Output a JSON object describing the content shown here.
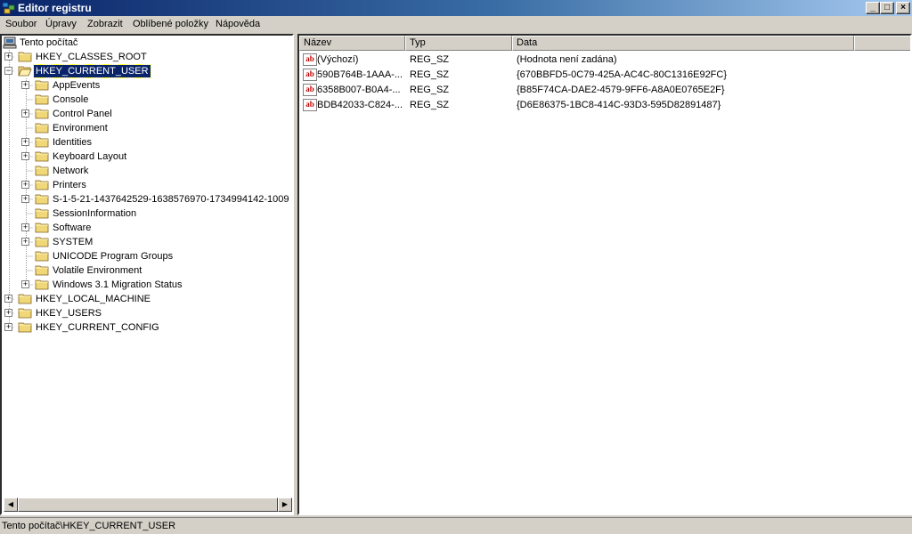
{
  "window": {
    "title": "Editor registru"
  },
  "menu": [
    "Soubor",
    "Úpravy",
    "Zobrazit",
    "Oblíbené položky",
    "Nápověda"
  ],
  "tree": {
    "root": "Tento počítač",
    "hives": [
      {
        "label": "HKEY_CLASSES_ROOT",
        "expander": "+"
      },
      {
        "label": "HKEY_CURRENT_USER",
        "expander": "−",
        "selected": true
      },
      {
        "label": "HKEY_LOCAL_MACHINE",
        "expander": "+"
      },
      {
        "label": "HKEY_USERS",
        "expander": "+"
      },
      {
        "label": "HKEY_CURRENT_CONFIG",
        "expander": "+"
      }
    ],
    "hkcu_children": [
      {
        "label": "AppEvents",
        "expander": "+"
      },
      {
        "label": "Console",
        "expander": ""
      },
      {
        "label": "Control Panel",
        "expander": "+"
      },
      {
        "label": "Environment",
        "expander": ""
      },
      {
        "label": "Identities",
        "expander": "+"
      },
      {
        "label": "Keyboard Layout",
        "expander": "+"
      },
      {
        "label": "Network",
        "expander": ""
      },
      {
        "label": "Printers",
        "expander": "+"
      },
      {
        "label": "S-1-5-21-1437642529-1638576970-1734994142-1009",
        "expander": "+"
      },
      {
        "label": "SessionInformation",
        "expander": ""
      },
      {
        "label": "Software",
        "expander": "+"
      },
      {
        "label": "SYSTEM",
        "expander": "+"
      },
      {
        "label": "UNICODE Program Groups",
        "expander": ""
      },
      {
        "label": "Volatile Environment",
        "expander": ""
      },
      {
        "label": "Windows 3.1 Migration Status",
        "expander": "+"
      }
    ]
  },
  "list": {
    "columns": [
      "Název",
      "Typ",
      "Data"
    ],
    "rows": [
      {
        "name": "(Výchozí)",
        "type": "REG_SZ",
        "data": "(Hodnota není zadána)"
      },
      {
        "name": "590B764B-1AAA-...",
        "type": "REG_SZ",
        "data": "{670BBFD5-0C79-425A-AC4C-80C1316E92FC}"
      },
      {
        "name": "6358B007-B0A4-...",
        "type": "REG_SZ",
        "data": "{B85F74CA-DAE2-4579-9FF6-A8A0E0765E2F}"
      },
      {
        "name": "BDB42033-C824-...",
        "type": "REG_SZ",
        "data": "{D6E86375-1BC8-414C-93D3-595D82891487}"
      }
    ],
    "value_icon": "ab"
  },
  "status": {
    "path": "Tento počítač\\HKEY_CURRENT_USER"
  },
  "title_buttons": {
    "minimize": "_",
    "maximize": "□",
    "close": "×"
  },
  "colors": {
    "title_start": "#0a246a",
    "title_end": "#a6caf0",
    "selection": "#0a246a",
    "folder": "#f0d878"
  }
}
